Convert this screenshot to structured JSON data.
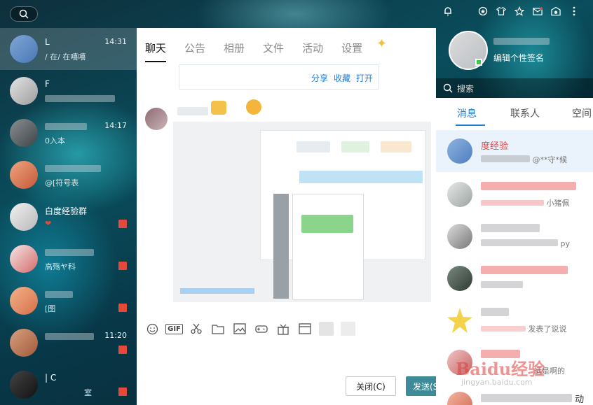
{
  "left_list": {
    "conversations": [
      {
        "name": "L",
        "time": "14:31",
        "preview": "/ 在/ 在嘻嘻",
        "active": true
      },
      {
        "name": "F",
        "time": "",
        "preview": "",
        "active": false
      },
      {
        "name": "",
        "time": "14:17",
        "preview": "0入本",
        "active": false
      },
      {
        "name": "",
        "time": "",
        "preview": "@[符号表",
        "active": false
      },
      {
        "name": "白度经验群",
        "time": "",
        "preview": "❤",
        "active": false
      },
      {
        "name": "",
        "time": "",
        "preview": "高殇ヤ科",
        "active": false
      },
      {
        "name": "",
        "time": "",
        "preview": "[图",
        "active": false
      },
      {
        "name": "",
        "time": "11:20",
        "preview": "",
        "active": false
      },
      {
        "name": "| C",
        "time": "",
        "preview": "室",
        "active": false
      }
    ]
  },
  "chat": {
    "tabs": [
      {
        "label": "聊天",
        "active": true
      },
      {
        "label": "公告",
        "active": false
      },
      {
        "label": "相册",
        "active": false
      },
      {
        "label": "文件",
        "active": false
      },
      {
        "label": "活动",
        "active": false
      },
      {
        "label": "设置",
        "active": false
      }
    ],
    "share_links": {
      "share": "分享",
      "collect": "收藏",
      "open": "打开"
    },
    "toolbar": {
      "gif_label": "GIF"
    },
    "buttons": {
      "close": "关闭(C)",
      "send": "发送(S)"
    }
  },
  "right_panel": {
    "signature": "编辑个性签名",
    "search_placeholder": "搜索",
    "tabs": [
      {
        "label": "消息",
        "active": true
      },
      {
        "label": "联系人",
        "active": false
      },
      {
        "label": "空间",
        "active": false
      }
    ],
    "items": [
      {
        "name": "度经验",
        "preview": "@**守*候",
        "active": true
      },
      {
        "name": "",
        "preview": "小猪佩",
        "active": false
      },
      {
        "name": "",
        "preview": "py",
        "active": false
      },
      {
        "name": "",
        "preview": "",
        "active": false
      },
      {
        "name": "",
        "preview": "发表了说说",
        "active": false
      },
      {
        "name": "",
        "preview": "运是啊的",
        "active": false
      },
      {
        "name": "",
        "preview": "动",
        "active": false
      }
    ]
  },
  "watermark": {
    "brand": "Baidu经验",
    "url": "jingyan.baidu.com"
  },
  "colors": {
    "accent": "#1f7bd3",
    "send_button": "#3d8a98",
    "badge": "#e5493a"
  }
}
